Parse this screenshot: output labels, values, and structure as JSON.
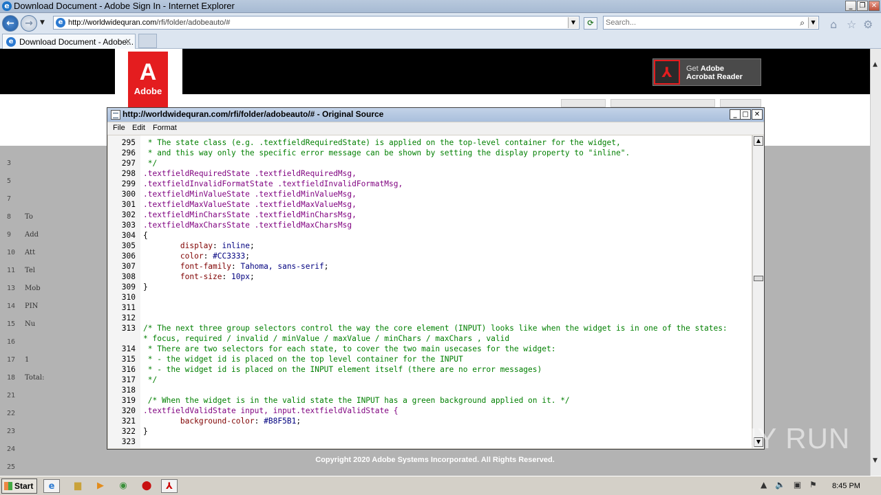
{
  "browser": {
    "window_title": "Download Document - Adobe Sign In - Internet Explorer",
    "address_host": "http://worldwidequran.com",
    "address_path": "/rfi/folder/adobeauto/#",
    "search_placeholder": "Search...",
    "tab_label": "Download Document - Adobe...",
    "tab_close": "×"
  },
  "page": {
    "logo_mark": "A",
    "logo_text": "Adobe",
    "reader_get": "Get",
    "reader_adobe": "Adobe",
    "reader_line2": "Acrobat Reader",
    "copyright": "Copyright 2020 Adobe Systems Incorporated. All Rights Reserved.",
    "sheet_rows": [
      {
        "n": "3",
        "t": ""
      },
      {
        "n": "5",
        "t": ""
      },
      {
        "n": "7",
        "t": ""
      },
      {
        "n": "8",
        "t": "To"
      },
      {
        "n": "9",
        "t": "Add"
      },
      {
        "n": "10",
        "t": "Att"
      },
      {
        "n": "11",
        "t": "Tel"
      },
      {
        "n": "13",
        "t": "Mob"
      },
      {
        "n": "14",
        "t": "PIN"
      },
      {
        "n": "15",
        "t": "Nu"
      },
      {
        "n": "16",
        "t": ""
      },
      {
        "n": "17",
        "t": "1"
      },
      {
        "n": "18",
        "t": "Total:"
      },
      {
        "n": "21",
        "t": ""
      },
      {
        "n": "22",
        "t": ""
      },
      {
        "n": "23",
        "t": ""
      },
      {
        "n": "24",
        "t": ""
      },
      {
        "n": "25",
        "t": ""
      }
    ]
  },
  "source_window": {
    "title": "http://worldwidequran.com/rfi/folder/adobeauto/# - Original Source",
    "menu": [
      "File",
      "Edit",
      "Format"
    ],
    "lines": [
      {
        "n": "295",
        "cls": "c-com",
        "t": " * The state class (e.g. .textfieldRequiredState) is applied on the top-level container for the widget,"
      },
      {
        "n": "296",
        "cls": "c-com",
        "t": " * and this way only the specific error message can be shown by setting the display property to \"inline\"."
      },
      {
        "n": "297",
        "cls": "c-com",
        "t": " */"
      },
      {
        "n": "298",
        "cls": "c-sel",
        "t": ".textfieldRequiredState .textfieldRequiredMsg,"
      },
      {
        "n": "299",
        "cls": "c-sel",
        "t": ".textfieldInvalidFormatState .textfieldInvalidFormatMsg,"
      },
      {
        "n": "300",
        "cls": "c-sel",
        "t": ".textfieldMinValueState .textfieldMinValueMsg,"
      },
      {
        "n": "301",
        "cls": "c-sel",
        "t": ".textfieldMaxValueState .textfieldMaxValueMsg,"
      },
      {
        "n": "302",
        "cls": "c-sel",
        "t": ".textfieldMinCharsState .textfieldMinCharsMsg,"
      },
      {
        "n": "303",
        "cls": "c-sel",
        "t": ".textfieldMaxCharsState .textfieldMaxCharsMsg"
      },
      {
        "n": "304",
        "cls": "c-plain",
        "t": "{"
      },
      {
        "n": "305",
        "cls": "c-decl",
        "t": "        ",
        "p": "display",
        "v": "inline"
      },
      {
        "n": "306",
        "cls": "c-decl",
        "t": "        ",
        "p": "color",
        "v": "#CC3333"
      },
      {
        "n": "307",
        "cls": "c-decl",
        "t": "        ",
        "p": "font-family",
        "v": "Tahoma, sans-serif"
      },
      {
        "n": "308",
        "cls": "c-decl",
        "t": "        ",
        "p": "font-size",
        "v": "10px"
      },
      {
        "n": "309",
        "cls": "c-plain",
        "t": "}"
      },
      {
        "n": "310",
        "cls": "c-plain",
        "t": ""
      },
      {
        "n": "311",
        "cls": "c-plain",
        "t": ""
      },
      {
        "n": "312",
        "cls": "c-plain",
        "t": ""
      },
      {
        "n": "313",
        "cls": "c-com",
        "t": "/* The next three group selectors control the way the core element (INPUT) looks like when the widget is in one of the states:"
      },
      {
        "n": "",
        "cls": "c-com",
        "t": "* focus, required / invalid / minValue / maxValue / minChars / maxChars , valid"
      },
      {
        "n": "314",
        "cls": "c-com",
        "t": " * There are two selectors for each state, to cover the two main usecases for the widget:"
      },
      {
        "n": "315",
        "cls": "c-com",
        "t": " * - the widget id is placed on the top level container for the INPUT"
      },
      {
        "n": "316",
        "cls": "c-com",
        "t": " * - the widget id is placed on the INPUT element itself (there are no error messages)"
      },
      {
        "n": "317",
        "cls": "c-com",
        "t": " */"
      },
      {
        "n": "318",
        "cls": "c-plain",
        "t": ""
      },
      {
        "n": "319",
        "cls": "c-com",
        "t": " /* When the widget is in the valid state the INPUT has a green background applied on it. */"
      },
      {
        "n": "320",
        "cls": "c-sel",
        "t": ".textfieldValidState input, input.textfieldValidState {"
      },
      {
        "n": "321",
        "cls": "c-decl",
        "t": "        ",
        "p": "background-color",
        "v": "#B8F5B1"
      },
      {
        "n": "322",
        "cls": "c-plain",
        "t": "}"
      },
      {
        "n": "323",
        "cls": "c-plain",
        "t": ""
      }
    ]
  },
  "taskbar": {
    "start_label": "Start",
    "clock": "8:45 PM"
  },
  "watermark": "ANY RUN"
}
